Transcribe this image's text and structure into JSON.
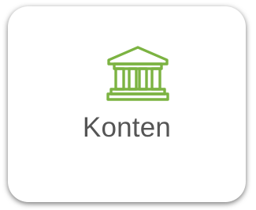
{
  "tile": {
    "icon_name": "bank-icon",
    "accent_color": "#7cb342",
    "label": "Konten"
  }
}
